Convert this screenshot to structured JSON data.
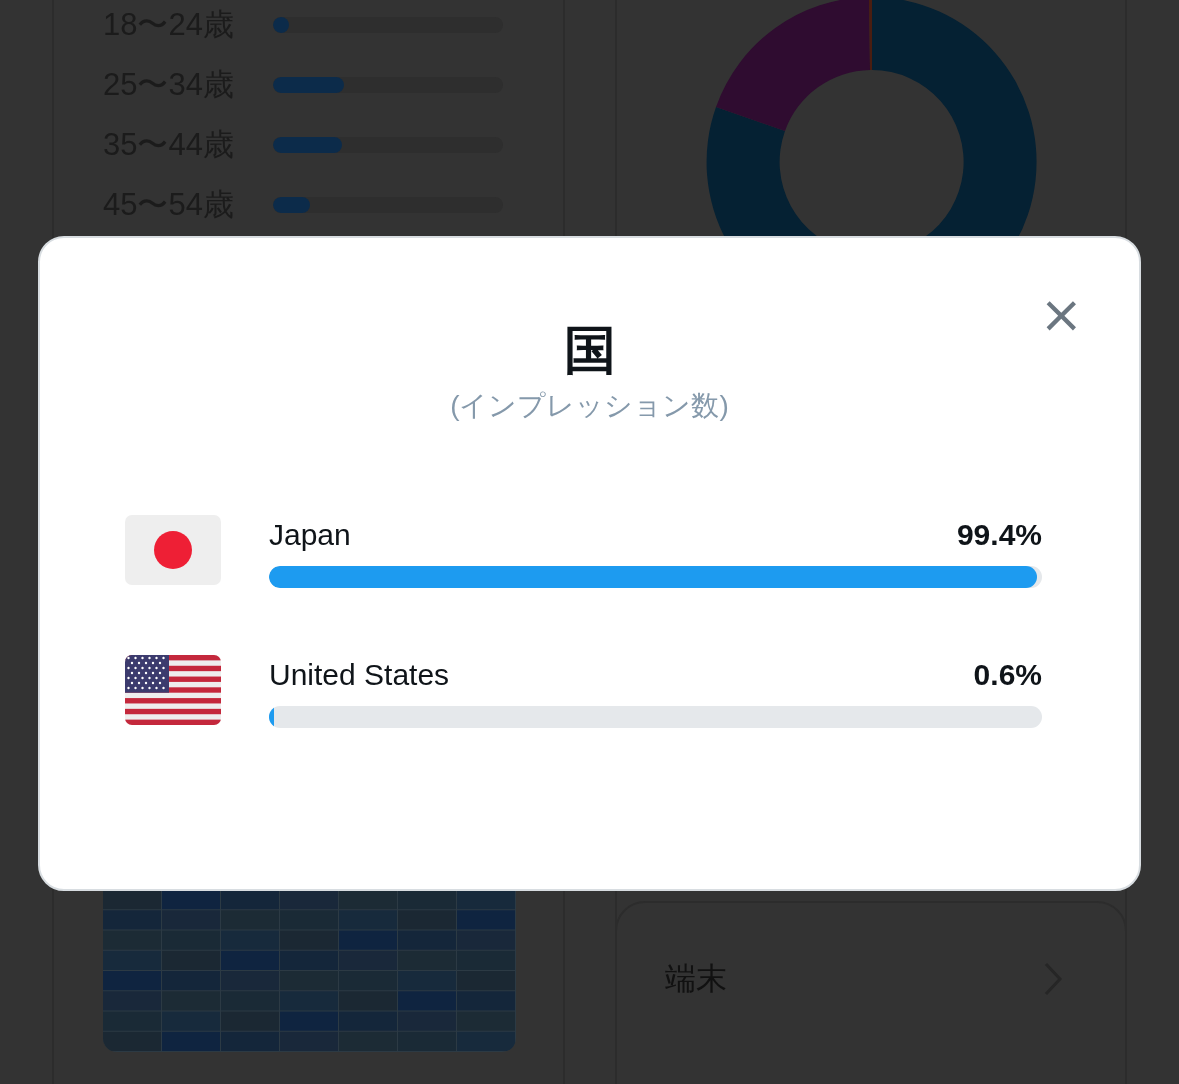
{
  "age_groups": [
    {
      "label": "18〜24歳",
      "level": 0.03
    },
    {
      "label": "25〜34歳",
      "level": 0.31
    },
    {
      "label": "35〜44歳",
      "level": 0.3
    },
    {
      "label": "45〜54歳",
      "level": 0.16
    }
  ],
  "device_card": {
    "title": "端末"
  },
  "dialog": {
    "title": "国",
    "subtitle": "(インプレッション数)",
    "close": "×",
    "countries": [
      {
        "kind": "jp",
        "name": "Japan",
        "percent": "99.4%",
        "level": 0.994
      },
      {
        "kind": "us",
        "name": "United States",
        "percent": "0.6%",
        "level": 0.006
      }
    ]
  }
}
